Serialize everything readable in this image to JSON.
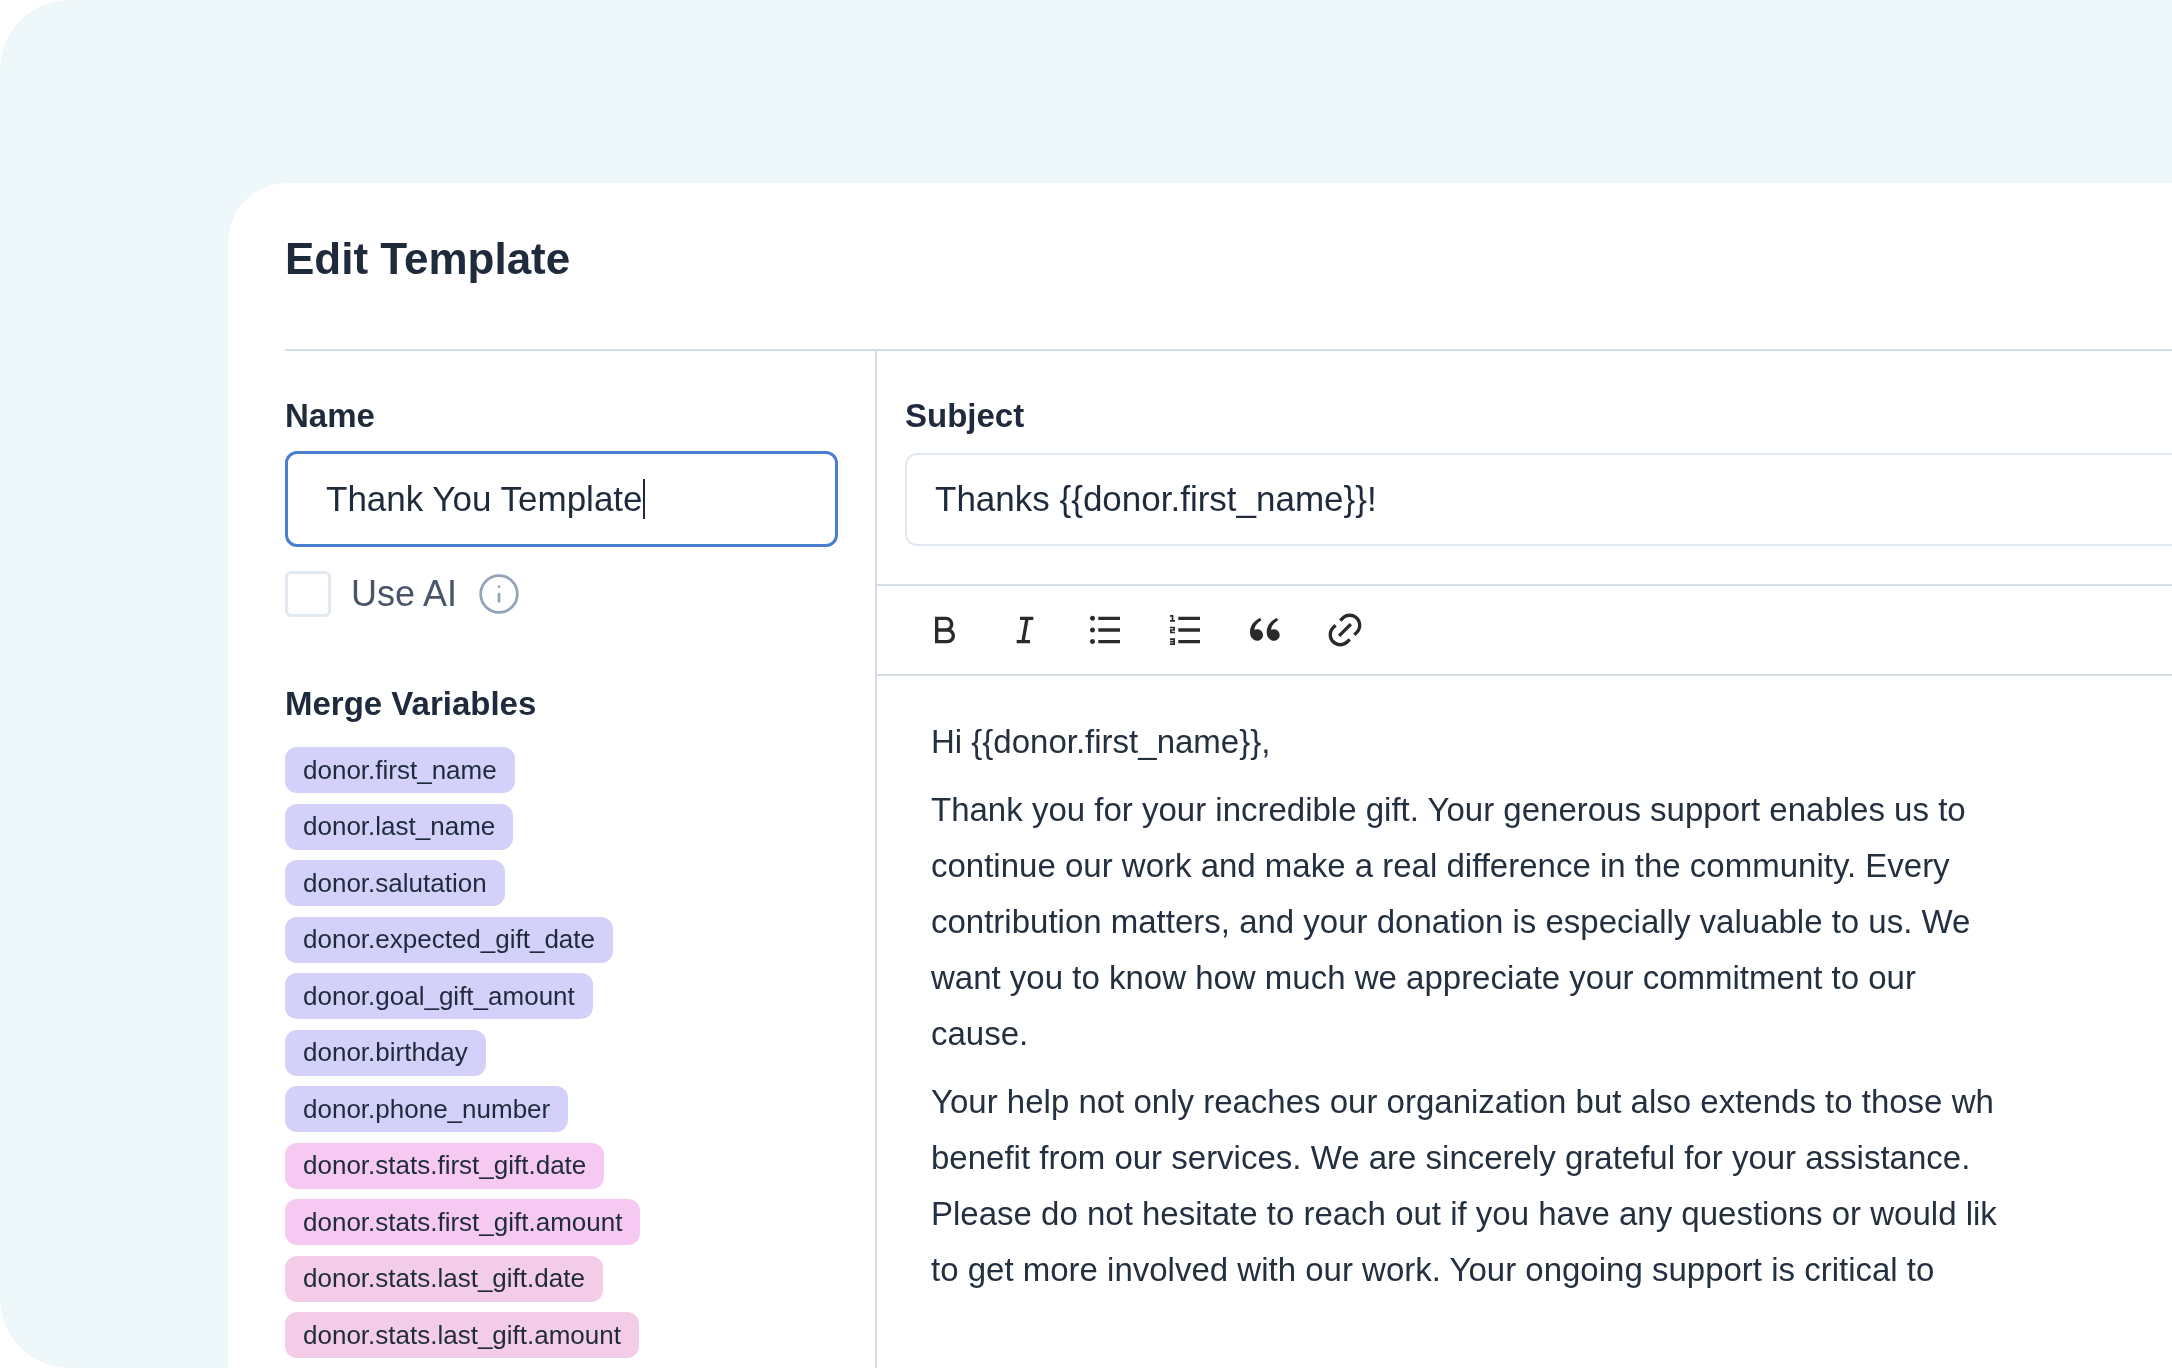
{
  "title": "Edit Template",
  "name_field": {
    "label": "Name",
    "value": "Thank You Template",
    "focused": true
  },
  "use_ai": {
    "label": "Use AI",
    "checked": false
  },
  "merge_variables": {
    "title": "Merge Variables",
    "tags": [
      {
        "label": "donor.first_name",
        "color": "#d3d0fa"
      },
      {
        "label": "donor.last_name",
        "color": "#d3d0fa"
      },
      {
        "label": "donor.salutation",
        "color": "#d3d0fa"
      },
      {
        "label": "donor.expected_gift_date",
        "color": "#d3d0fa"
      },
      {
        "label": "donor.goal_gift_amount",
        "color": "#d3d0fa"
      },
      {
        "label": "donor.birthday",
        "color": "#d3d0fa"
      },
      {
        "label": "donor.phone_number",
        "color": "#d3d0fa"
      },
      {
        "label": "donor.stats.first_gift.date",
        "color": "#f5c9f2"
      },
      {
        "label": "donor.stats.first_gift.amount",
        "color": "#f5c9f2"
      },
      {
        "label": "donor.stats.last_gift.date",
        "color": "#f3cde8"
      },
      {
        "label": "donor.stats.last_gift.amount",
        "color": "#f3cde8"
      }
    ]
  },
  "subject_field": {
    "label": "Subject",
    "value": "Thanks {{donor.first_name}}!"
  },
  "toolbar": [
    {
      "kind": "bold"
    },
    {
      "kind": "italic"
    },
    {
      "kind": "bullet-list"
    },
    {
      "kind": "numbered-list"
    },
    {
      "kind": "quote"
    },
    {
      "kind": "link"
    }
  ],
  "body": {
    "paragraphs": [
      {
        "lines": [
          "Hi {{donor.first_name}},"
        ]
      },
      {
        "lines": [
          "Thank you for your incredible gift. Your generous support enables us to",
          "continue our work and make a real difference in the community. Every",
          "contribution matters, and your donation is especially valuable to us. We",
          "want you to know how much we appreciate your commitment to our",
          "cause."
        ]
      },
      {
        "lines": [
          "Your help not only reaches our organization but also extends to those wh",
          "benefit from our services. We are sincerely grateful for your assistance.",
          "Please do not hesitate to reach out if you have any questions or would lik",
          "to get more involved with our work. Your ongoing support is critical to"
        ]
      }
    ]
  }
}
